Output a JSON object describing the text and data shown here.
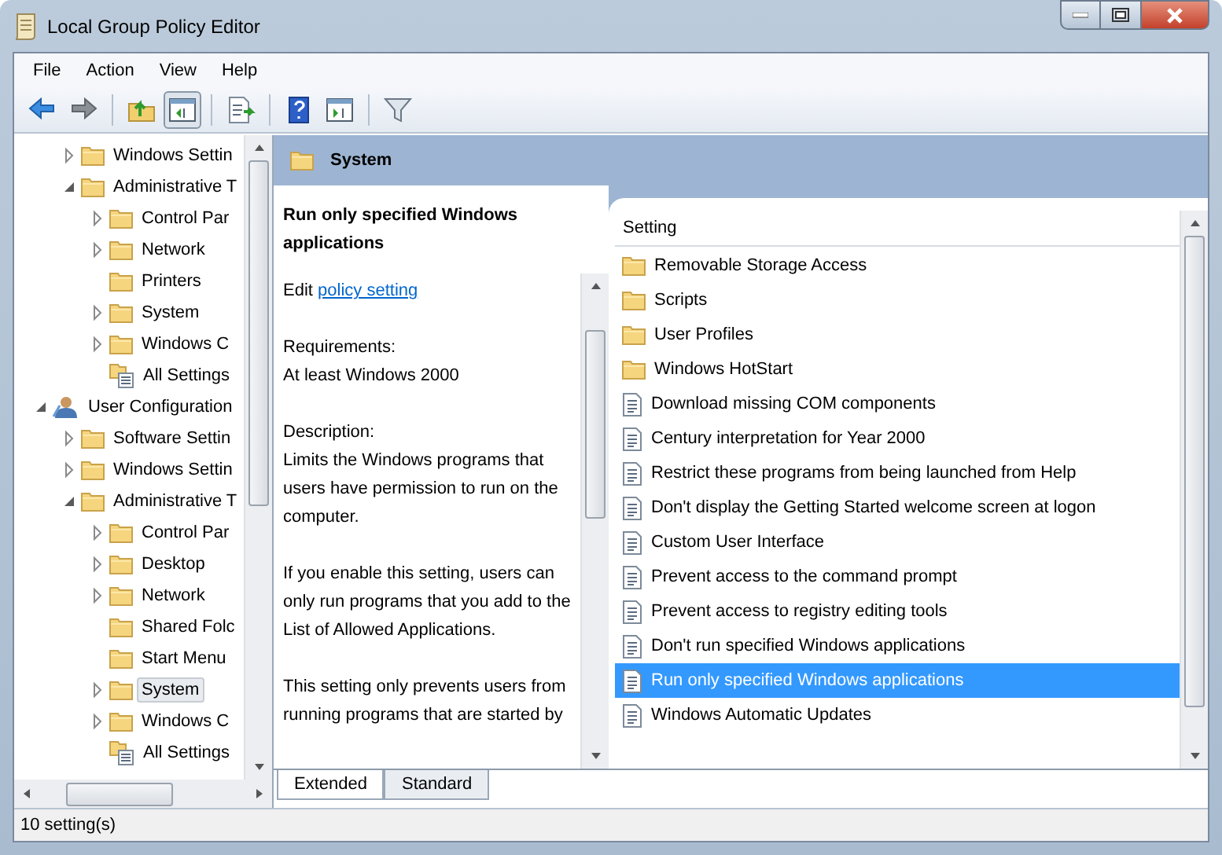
{
  "window": {
    "title": "Local Group Policy Editor"
  },
  "menu": [
    "File",
    "Action",
    "View",
    "Help"
  ],
  "toolbar": [
    {
      "kind": "back",
      "on": false
    },
    {
      "kind": "forward",
      "on": false
    },
    {
      "kind": "up",
      "on": false
    },
    {
      "kind": "tree",
      "on": true
    },
    {
      "kind": "export",
      "on": false
    },
    {
      "kind": "help",
      "on": false
    },
    {
      "kind": "view",
      "on": false
    },
    {
      "kind": "filter",
      "on": false
    }
  ],
  "tree": [
    {
      "children": [
        {
          "label": "Windows Settin",
          "kind": "folder",
          "expanded": false,
          "selected": false
        },
        {
          "label": "Administrative T",
          "kind": "folder",
          "expanded": true,
          "selected": false,
          "children": [
            {
              "label": "Control Par",
              "kind": "folder",
              "expanded": false,
              "selected": false
            },
            {
              "label": "Network",
              "kind": "folder",
              "expanded": false,
              "selected": false
            },
            {
              "label": "Printers",
              "kind": "folder",
              "selected": false
            },
            {
              "label": "System",
              "kind": "folder",
              "expanded": false,
              "selected": false
            },
            {
              "label": "Windows C",
              "kind": "folder",
              "expanded": false,
              "selected": false
            },
            {
              "label": "All Settings",
              "kind": "settings",
              "selected": false
            }
          ]
        }
      ]
    },
    {
      "label": "User Configuration",
      "kind": "user",
      "expanded": true,
      "selected": false,
      "children": [
        {
          "label": "Software Settin",
          "kind": "folder",
          "expanded": false,
          "selected": false
        },
        {
          "label": "Windows Settin",
          "kind": "folder",
          "expanded": false,
          "selected": false
        },
        {
          "label": "Administrative T",
          "kind": "folder",
          "expanded": true,
          "selected": false,
          "children": [
            {
              "label": "Control Par",
              "kind": "folder",
              "expanded": false,
              "selected": false
            },
            {
              "label": "Desktop",
              "kind": "folder",
              "expanded": false,
              "selected": false
            },
            {
              "label": "Network",
              "kind": "folder",
              "expanded": false,
              "selected": false
            },
            {
              "label": "Shared Folc",
              "kind": "folder",
              "selected": false
            },
            {
              "label": "Start Menu",
              "kind": "folder",
              "selected": false
            },
            {
              "label": "System",
              "kind": "folder",
              "expanded": false,
              "selected": true
            },
            {
              "label": "Windows C",
              "kind": "folder",
              "expanded": false,
              "selected": false
            },
            {
              "label": "All Settings",
              "kind": "settings",
              "selected": false
            }
          ]
        }
      ]
    }
  ],
  "header": {
    "title": "System"
  },
  "description": {
    "title": "Run only specified Windows applications",
    "edit_prefix": "Edit",
    "edit_link": "policy setting",
    "requirements_label": "Requirements:",
    "requirements": "At least Windows 2000",
    "description_label": "Description:",
    "paragraphs": [
      "Limits the Windows programs that users have permission to run on the computer.",
      "If you enable this setting, users can only run programs that you add to the List of Allowed Applications.",
      "This setting only prevents users from running programs that are started by"
    ]
  },
  "settings": {
    "column": "Setting",
    "items": [
      {
        "label": "Removable Storage Access",
        "kind": "folder",
        "selected": false
      },
      {
        "label": "Scripts",
        "kind": "folder",
        "selected": false
      },
      {
        "label": "User Profiles",
        "kind": "folder",
        "selected": false
      },
      {
        "label": "Windows HotStart",
        "kind": "folder",
        "selected": false
      },
      {
        "label": "Download missing COM components",
        "kind": "policy",
        "selected": false
      },
      {
        "label": "Century interpretation for Year 2000",
        "kind": "policy",
        "selected": false
      },
      {
        "label": "Restrict these programs from being launched from Help",
        "kind": "policy",
        "selected": false
      },
      {
        "label": "Don't display the Getting Started welcome screen at logon",
        "kind": "policy",
        "selected": false
      },
      {
        "label": "Custom User Interface",
        "kind": "policy",
        "selected": false
      },
      {
        "label": "Prevent access to the command prompt",
        "kind": "policy",
        "selected": false
      },
      {
        "label": "Prevent access to registry editing tools",
        "kind": "policy",
        "selected": false
      },
      {
        "label": "Don't run specified Windows applications",
        "kind": "policy",
        "selected": false
      },
      {
        "label": "Run only specified Windows applications",
        "kind": "policy",
        "selected": true
      },
      {
        "label": "Windows Automatic Updates",
        "kind": "policy",
        "selected": false
      }
    ]
  },
  "tabs": [
    {
      "label": "Extended",
      "selected": true
    },
    {
      "label": "Standard",
      "selected": false
    }
  ],
  "status_bar": "10 setting(s)"
}
